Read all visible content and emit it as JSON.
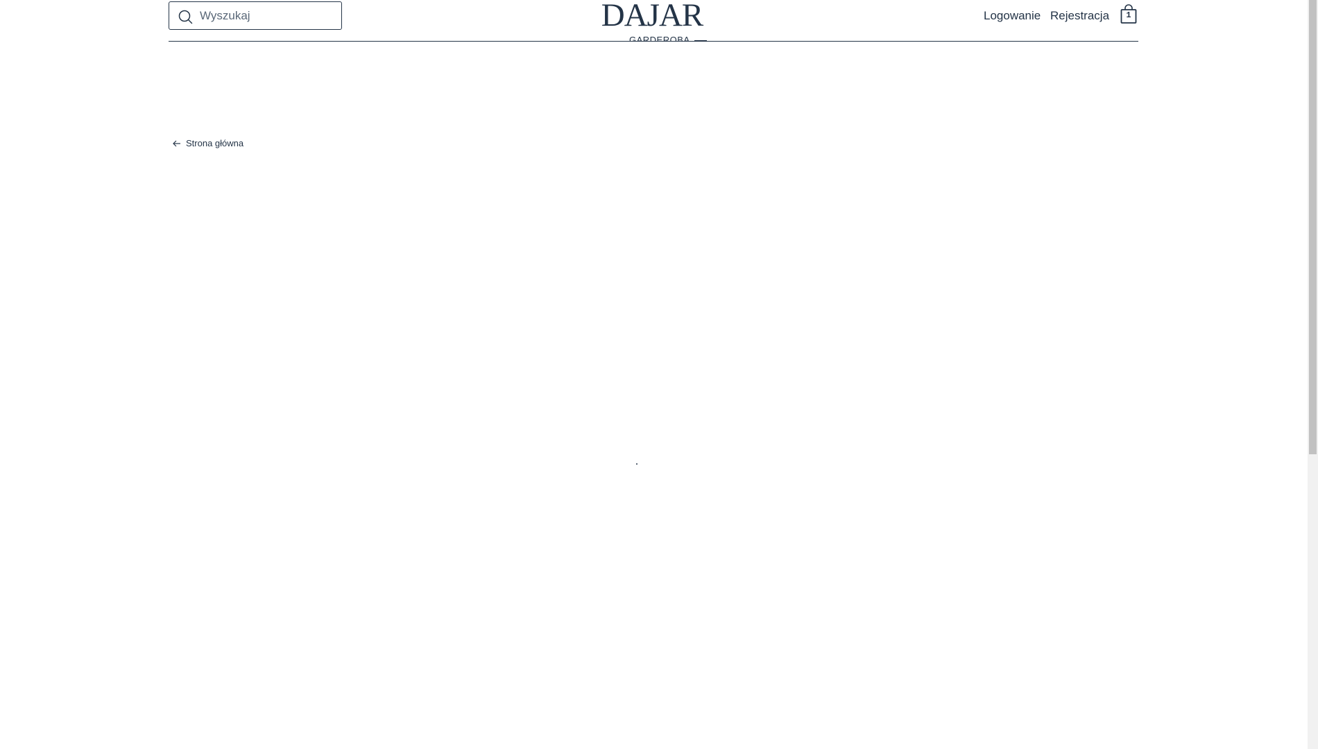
{
  "search": {
    "placeholder": "Wyszukaj",
    "icon": "search-icon"
  },
  "header": {
    "logo": "DAJAR",
    "sub_nav_label": "GARDEROBA",
    "login_label": "Logowanie",
    "register_label": "Rejestracja",
    "cart_count": "1",
    "cart_icon": "shopping-bag-icon"
  },
  "breadcrumb": {
    "back_label": "Strona główna",
    "icon": "arrow-left-icon"
  },
  "colors": {
    "primary": "#243447",
    "background": "#ffffff"
  }
}
